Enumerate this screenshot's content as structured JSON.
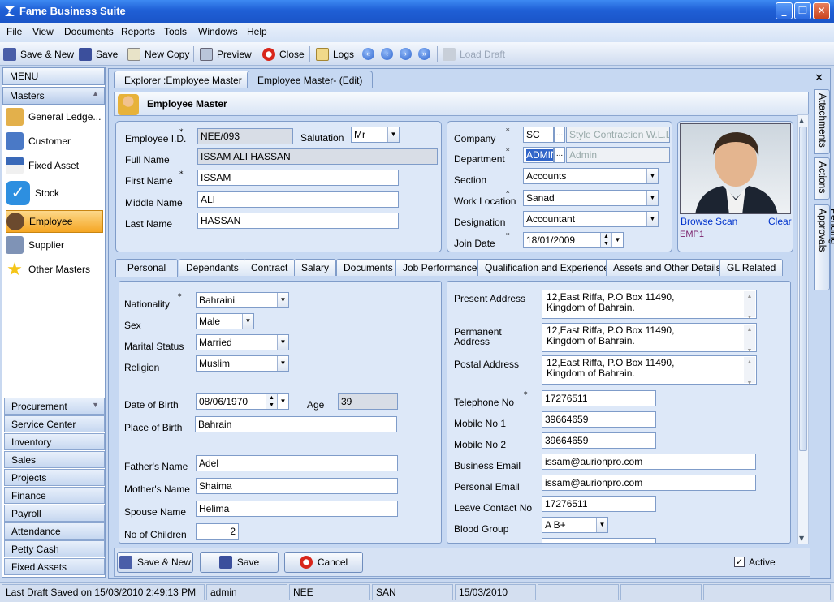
{
  "app": {
    "title": "Fame Business Suite"
  },
  "menu": [
    "File",
    "View",
    "Documents",
    "Reports",
    "Tools",
    "Windows",
    "Help"
  ],
  "toolbar": {
    "save_new": "Save & New",
    "save": "Save",
    "new_copy": "New Copy",
    "preview": "Preview",
    "close": "Close",
    "logs": "Logs",
    "load_draft": "Load Draft"
  },
  "sidebar": {
    "menu_label": "MENU",
    "masters_label": "Masters",
    "items": [
      {
        "label": "General Ledge...",
        "icon": "clipboard-icon"
      },
      {
        "label": "Customer",
        "icon": "customer-icon"
      },
      {
        "label": "Fixed Asset",
        "icon": "house-icon"
      },
      {
        "label": "Stock",
        "icon": "checkmark-icon"
      },
      {
        "label": "Employee",
        "icon": "employee-icon"
      },
      {
        "label": "Supplier",
        "icon": "supplier-icon"
      },
      {
        "label": "Other Masters",
        "icon": "star-icon"
      }
    ],
    "categories": [
      "Procurement",
      "Service Center",
      "Inventory",
      "Sales",
      "Projects",
      "Finance",
      "Payroll",
      "Attendance",
      "Petty Cash",
      "Fixed Assets"
    ]
  },
  "tabs": {
    "explorer": "Explorer :Employee Master",
    "edit": "Employee Master- (Edit)"
  },
  "form": {
    "title": "Employee Master",
    "labels": {
      "employee_id": "Employee I.D.",
      "salutation": "Salutation",
      "full_name": "Full Name",
      "first_name": "First Name",
      "middle_name": "Middle Name",
      "last_name": "Last Name",
      "company": "Company",
      "department": "Department",
      "section": "Section",
      "work_location": "Work Location",
      "designation": "Designation",
      "join_date": "Join Date"
    },
    "employee_id": "NEE/093",
    "salutation": "Mr",
    "full_name": "ISSAM ALI HASSAN",
    "first_name": "ISSAM",
    "middle_name": "ALI",
    "last_name": "HASSAN",
    "company_code": "SC",
    "company_name": "Style Contraction W.L.L.",
    "department_code": "ADMIN",
    "department_name": "Admin",
    "section": "Accounts",
    "work_location": "Sanad",
    "designation": "Accountant",
    "join_date": "18/01/2009",
    "photo": {
      "browse": "Browse",
      "scan": "Scan",
      "clear": "Clear",
      "code": "EMP1"
    }
  },
  "subtabs": [
    "Personal",
    "Dependants",
    "Contract",
    "Salary",
    "Documents",
    "Job Performance",
    "Qualification and Experience",
    "Assets and Other Details",
    "GL Related"
  ],
  "personal": {
    "labels": {
      "nationality": "Nationality",
      "sex": "Sex",
      "marital_status": "Marital Status",
      "religion": "Religion",
      "dob": "Date of Birth",
      "age": "Age",
      "place_of_birth": "Place of Birth",
      "father": "Father's Name",
      "mother": "Mother's Name",
      "spouse": "Spouse Name",
      "children": "No of Children"
    },
    "nationality": "Bahraini",
    "sex": "Male",
    "marital_status": "Married",
    "religion": "Muslim",
    "dob": "08/06/1970",
    "age": "39",
    "place_of_birth": "Bahrain",
    "father": "Adel",
    "mother": "Shaima",
    "spouse": "Helima",
    "children": "2"
  },
  "contact": {
    "labels": {
      "present": "Present Address",
      "permanent1": "Permanent",
      "permanent2": "Address",
      "postal": "Postal Address",
      "telephone": "Telephone No",
      "mobile1": "Mobile No 1",
      "mobile2": "Mobile No 2",
      "business_email": "Business Email",
      "personal_email": "Personal Email",
      "leave_contact": "Leave Contact No",
      "blood_group": "Blood Group"
    },
    "address_line1": "12,East Riffa, P.O Box 11490,",
    "address_line2": "Kingdom of Bahrain.",
    "telephone": "17276511",
    "mobile1": "39664659",
    "mobile2": "39664659",
    "business_email": "issam@aurionpro.com",
    "personal_email": "issam@aurionpro.com",
    "leave_contact": "17276511",
    "blood_group": "A B+"
  },
  "buttons": {
    "save_new": "Save & New",
    "save": "Save",
    "cancel": "Cancel",
    "active": "Active"
  },
  "side_tabs": [
    "Attachments",
    "Actions",
    "Pending Approvals"
  ],
  "status": [
    "Last Draft Saved on 15/03/2010 2:49:13 PM",
    "admin",
    "NEE",
    "SAN",
    "15/03/2010"
  ],
  "colors": {
    "accent": "#1f5fd6",
    "active_item": "#f5a623",
    "panel": "#dde8f8"
  }
}
